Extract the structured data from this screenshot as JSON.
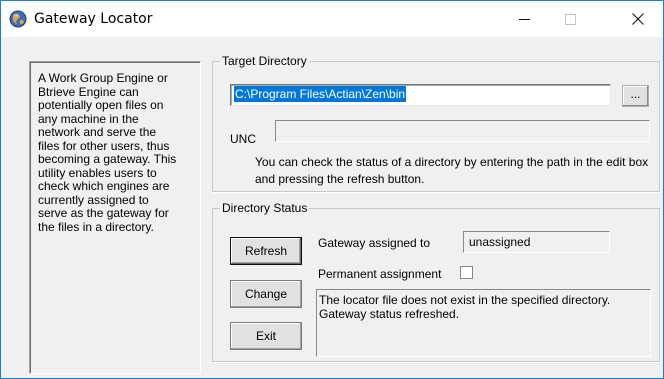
{
  "window": {
    "title": "Gateway Locator",
    "minimize_glyph": "—",
    "maximize_glyph": "☐",
    "close_glyph": "✕"
  },
  "info": {
    "text": "A Work Group Engine or\nBtrieve Engine can\npotentially open files on\nany machine in the\nnetwork and serve the\nfiles for other users, thus\nbecoming a gateway. This\nutility enables users to\ncheck which engines are\ncurrently assigned to\nserve as the gateway for\nthe files in a directory."
  },
  "target_directory": {
    "group_title": "Target Directory",
    "path_value": "C:\\Program Files\\Actian\\Zen\\bin",
    "browse_label": "...",
    "unc_label": "UNC",
    "unc_value": "",
    "hint": "You can check the status of a directory by entering the path in the edit box and pressing the refresh button."
  },
  "directory_status": {
    "group_title": "Directory Status",
    "refresh_label": "Refresh",
    "change_label": "Change",
    "exit_label": "Exit",
    "gateway_label": "Gateway assigned to",
    "gateway_value": "unassigned",
    "permanent_label": "Permanent assignment",
    "permanent_checked": false,
    "message": "The locator file does not exist in the specified directory.\nGateway status refreshed."
  },
  "icons": {
    "app": "gateway-globe-icon"
  }
}
